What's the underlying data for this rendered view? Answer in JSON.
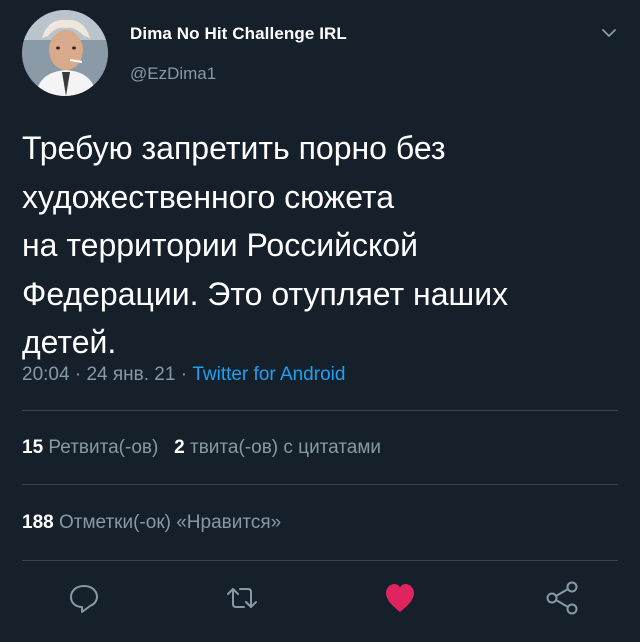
{
  "tweet": {
    "display_name": "Dima No Hit Challenge IRL",
    "handle": "@EzDima1",
    "text": "Требую запретить порно без\nхудожественного сюжета\nна территории Российской\nФедерации. Это отупляет наших\nдетей.",
    "time": "20:04",
    "date": "24 янв. 21",
    "separator": "·",
    "source": "Twitter for Android"
  },
  "stats": {
    "retweets_count": "15",
    "retweets_label": "Ретвита(-ов)",
    "quotes_count": "2",
    "quotes_label": "твита(-ов) с цитатами",
    "likes_count": "188",
    "likes_label": "Отметки(-ок) «Нравится»"
  },
  "actions": {
    "reply_icon": "reply-icon",
    "retweet_icon": "retweet-icon",
    "like_icon": "heart-icon",
    "share_icon": "share-icon",
    "liked": true
  },
  "colors": {
    "background": "#15202b",
    "secondary_text": "#8899a6",
    "link": "#1da1f2",
    "like": "#e0245e",
    "divider": "#38444d"
  }
}
